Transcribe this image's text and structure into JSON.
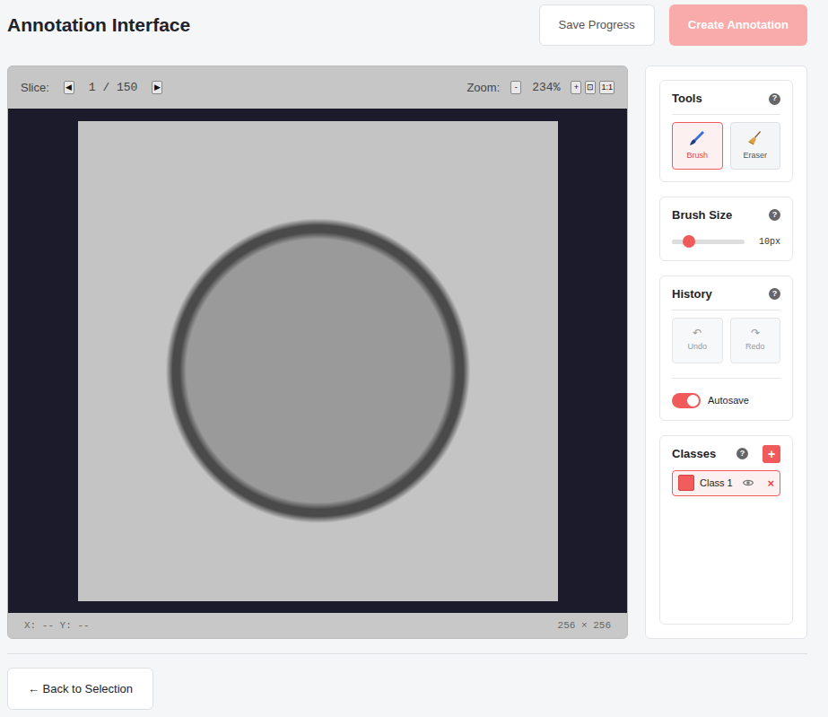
{
  "header": {
    "title": "Annotation Interface"
  },
  "actions": [
    {
      "label": "Save Progress",
      "disabled": false
    },
    {
      "label": "Create Annotation",
      "disabled": true
    }
  ],
  "viewer": {
    "slice_label": "Slice:",
    "slice_prev": "◀",
    "slice": "1 / 150",
    "slice_next": "▶",
    "zoom_label": "Zoom:",
    "zoom_out": "-",
    "zoom": "234%",
    "zoom_in": "+",
    "fit": "⊡",
    "actual": "1:1",
    "coords": "X: -- Y: --",
    "dimensions": "256 × 256"
  },
  "tools": {
    "title": "Tools",
    "help": "?",
    "items": [
      {
        "label": "Brush",
        "selected": true
      },
      {
        "label": "Eraser",
        "selected": false
      }
    ]
  },
  "brush": {
    "title": "Brush Size",
    "help": "?",
    "level": 0.23,
    "reading": "10px"
  },
  "history": {
    "title": "History",
    "help": "?",
    "buttons": [
      {
        "label": "Undo",
        "icon": "↶",
        "disabled": true
      },
      {
        "label": "Redo",
        "icon": "↷",
        "disabled": true
      }
    ],
    "autosave": {
      "label": "Autosave",
      "on": true
    }
  },
  "classes": {
    "title": "Classes",
    "help": "?",
    "add": "+",
    "items": [
      {
        "name": "Class 1",
        "color": "#f25c5c",
        "visible": true,
        "selected": true,
        "remove": "×"
      }
    ]
  },
  "back": "← Back to Selection"
}
